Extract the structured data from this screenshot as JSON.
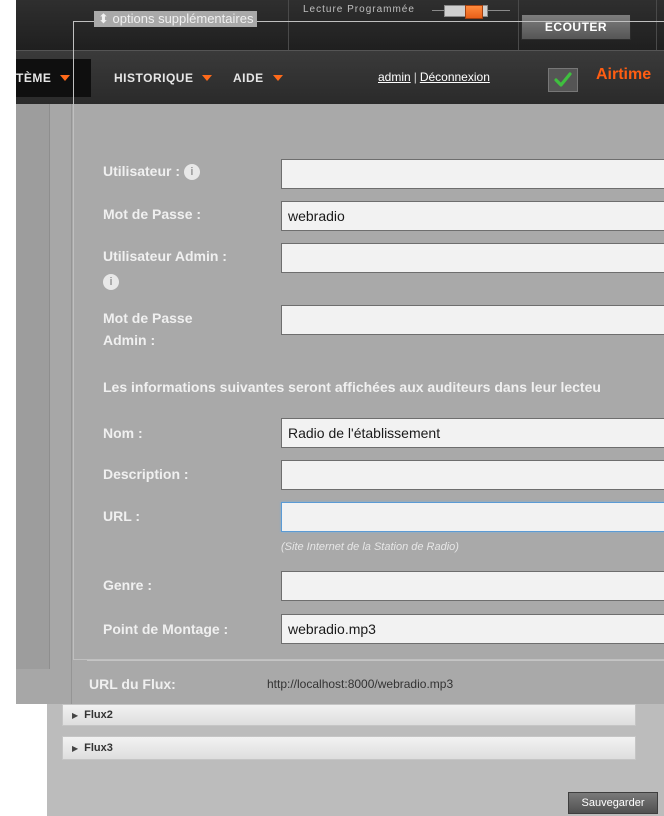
{
  "header": {
    "scheduled_playback_label": "Lecture Programmée",
    "listen_button": "ECOUTER"
  },
  "nav": {
    "system_label": "TÈME",
    "history_label": "HISTORIQUE",
    "help_label": "AIDE",
    "username": "admin",
    "separator": "|",
    "logout": "Déconnexion",
    "brand": "Airtime"
  },
  "form": {
    "legend": "options supplémentaires",
    "user_label": "Utilisateur :",
    "password_label": "Mot de Passe :",
    "password_value": "webradio",
    "admin_user_label": "Utilisateur Admin :",
    "admin_password_label_line1": "Mot de Passe",
    "admin_password_label_line2": "Admin :",
    "info_text": "Les informations suivantes seront affichées aux auditeurs dans leur lecteu",
    "name_label": "Nom :",
    "name_value": "Radio de l'établissement",
    "description_label": "Description :",
    "url_label": "URL :",
    "url_hint": "(Site Internet de la Station de Radio)",
    "genre_label": "Genre :",
    "mount_label": "Point de Montage :",
    "mount_value": "webradio.mp3",
    "stream_url_label": "URL du Flux:",
    "stream_url_value": "http://localhost:8000/webradio.mp3"
  },
  "lower": {
    "flux2_label": "Flux2",
    "flux3_label": "Flux3",
    "save_button": "Sauvegarder"
  },
  "colors": {
    "accent": "#ff6a1a",
    "panel": "#a9a9a9",
    "check": "#3fbf3f"
  }
}
